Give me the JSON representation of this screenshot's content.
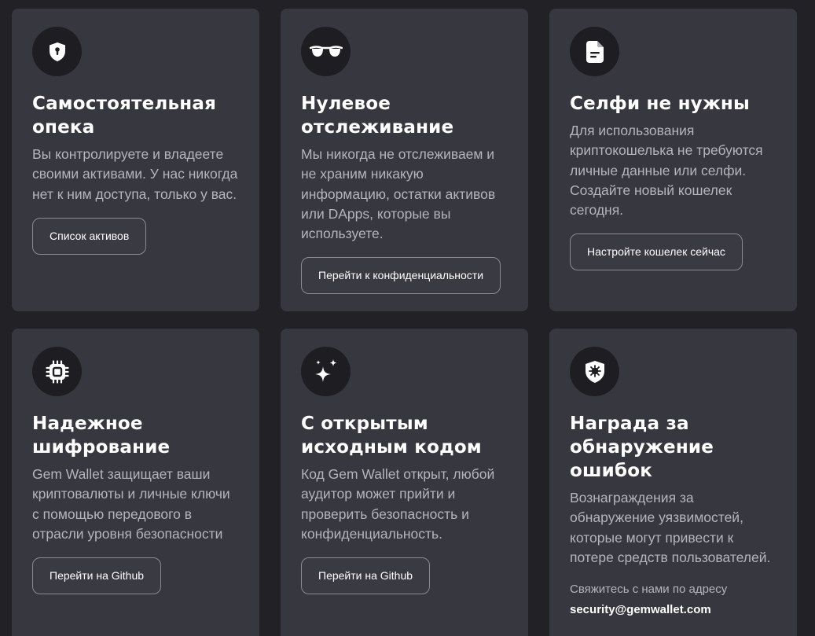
{
  "cards": [
    {
      "icon": "shield-lock-icon",
      "title": "Самостоятельная опека",
      "description": "Вы контролируете и владеете своими активами. У нас никогда нет к ним доступа, только у вас.",
      "button": "Список активов"
    },
    {
      "icon": "sunglasses-icon",
      "title": "Нулевое отслеживание",
      "description": "Мы никогда не отслеживаем и не храним никакую информацию, остатки активов или DApps, которые вы используете.",
      "button": "Перейти к конфиденциальности"
    },
    {
      "icon": "document-icon",
      "title": "Селфи не нужны",
      "description": "Для использования криптокошелька не требуются личные данные или селфи. Создайте новый кошелек сегодня.",
      "button": "Настройте кошелек сейчас"
    },
    {
      "icon": "chip-icon",
      "title": "Надежное шифрование",
      "description": "Gem Wallet защищает ваши криптовалюты и личные ключи с помощью передового в отрасли уровня безопасности",
      "button": "Перейти на Github"
    },
    {
      "icon": "sparkles-icon",
      "title": "С открытым исходным кодом",
      "description": "Код Gem Wallet открыт, любой аудитор может прийти и проверить безопасность и конфиденциальность.",
      "button": "Перейти на Github"
    },
    {
      "icon": "shield-bug-icon",
      "title": "Награда за обнаружение ошибок",
      "description": "Вознаграждения за обнаружение уязвимостей, которые могут привести к потере средств пользователей.",
      "contact_label": "Свяжитесь с нами по адресу",
      "contact_email": "security@gemwallet.com"
    }
  ],
  "colors": {
    "background": "#222226",
    "card": "#37373f",
    "icon_bg": "#1e1e22",
    "title": "#ffffff",
    "text": "#b4b4bc",
    "button_border": "#8a8a92"
  }
}
